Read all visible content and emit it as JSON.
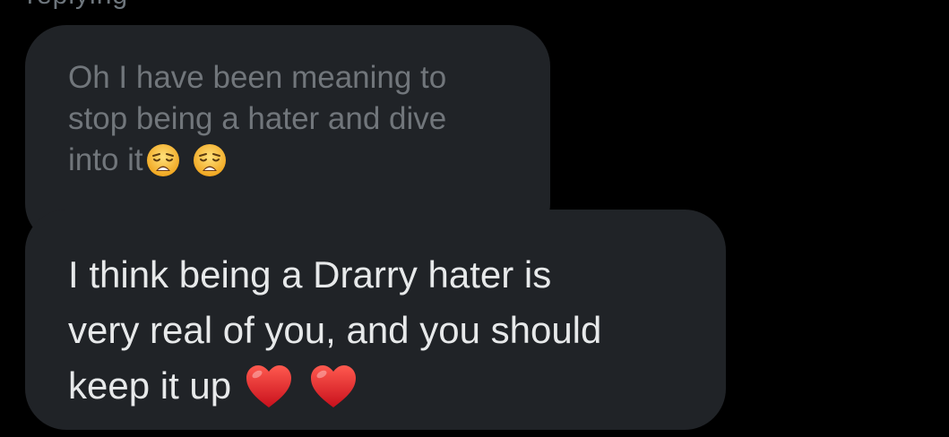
{
  "thread": {
    "top_fragment": "replying"
  },
  "quoted_message": {
    "lines": [
      "Oh I have been meaning to",
      "stop being a hater and dive",
      "into it"
    ],
    "trailing_emojis": [
      "weary-face-icon",
      "weary-face-icon"
    ]
  },
  "reply_message": {
    "lines": [
      "I think being a Drarry hater is",
      "very real of you, and you should",
      "keep it up"
    ],
    "trailing_emojis": [
      "red-heart-icon",
      "red-heart-icon"
    ]
  },
  "colors": {
    "background": "#000000",
    "bubble": "#202327",
    "quoted_text": "#71767b",
    "reply_text": "#e7e9ea",
    "heart": "#e0262b",
    "weary_face": "#f7b52a"
  }
}
